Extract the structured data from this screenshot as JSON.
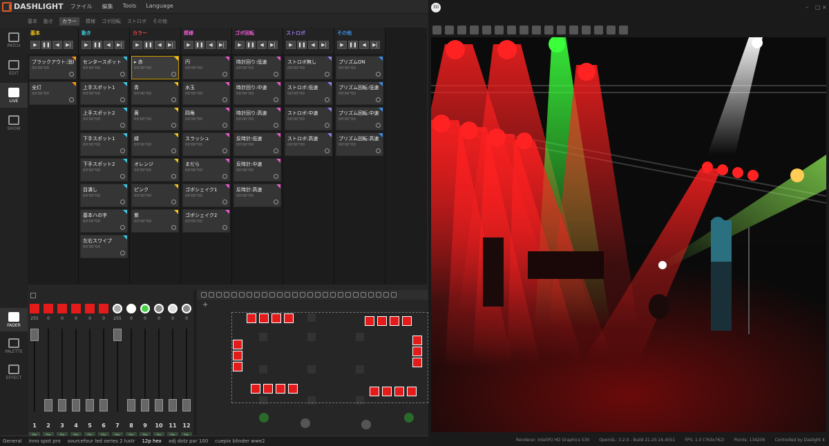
{
  "app": {
    "name": "DASHLIGHT"
  },
  "menu": [
    "ファイル",
    "編集",
    "Tools",
    "Language"
  ],
  "groups": [
    "基本",
    "動き",
    "カラー",
    "模様",
    "ゴボ回転",
    "ストロボ",
    "その他"
  ],
  "active_group": "カラー",
  "nav": {
    "patch": "PATCH",
    "edit": "EDIT",
    "live": "LIVE",
    "show": "SHOW"
  },
  "bnav": {
    "fader": "FADER",
    "palette": "PALETTE",
    "effect": "EFFECT"
  },
  "transport": {
    "play": "▶",
    "pause": "❚❚",
    "prev": "◀",
    "next": "▶|"
  },
  "columns": [
    {
      "name": "基本",
      "color": "#f5c518",
      "cues": [
        {
          "label": "ブラックアウト:消灯",
          "time": "00'00\"00",
          "tag": "#f90"
        },
        {
          "label": "全灯",
          "time": "00'00\"00",
          "tag": "#f90"
        }
      ]
    },
    {
      "name": "動き",
      "color": "#3cc8e0",
      "cues": [
        {
          "label": "センタースポット",
          "time": "00'00\"00",
          "tag": "#3cc8e0"
        },
        {
          "label": "上手スポット1",
          "time": "00'00\"00",
          "tag": "#3cc8e0"
        },
        {
          "label": "上手スポット2",
          "time": "00'00\"00",
          "tag": "#3cc8e0"
        },
        {
          "label": "下手スポット1",
          "time": "00'00\"00",
          "tag": "#3cc8e0"
        },
        {
          "label": "下手スポット2",
          "time": "00'00\"00",
          "tag": "#3cc8e0"
        },
        {
          "label": "目潰し",
          "time": "00'00\"00",
          "tag": "#3cc8e0"
        },
        {
          "label": "基本ハの字",
          "time": "00'00\"00",
          "tag": "#3cc8e0"
        },
        {
          "label": "左右スワイプ",
          "time": "00'00\"00",
          "tag": "#3cc8e0"
        }
      ]
    },
    {
      "name": "カラー",
      "color": "#e84a4a",
      "cues": [
        {
          "label": "▸ 赤",
          "time": "00'00\"00",
          "tag": "#f5c518"
        },
        {
          "label": "青",
          "time": "00'00\"00",
          "tag": "#f5c518"
        },
        {
          "label": "黄",
          "time": "00'00\"00",
          "tag": "#f5c518"
        },
        {
          "label": "緑",
          "time": "00'00\"00",
          "tag": "#f5c518"
        },
        {
          "label": "オレンジ",
          "time": "00'00\"00",
          "tag": "#f5c518"
        },
        {
          "label": "ピンク",
          "time": "00'00\"00",
          "tag": "#f5c518"
        },
        {
          "label": "紫",
          "time": "00'00\"00",
          "tag": "#f5c518"
        }
      ]
    },
    {
      "name": "模様",
      "color": "#e85ad0",
      "cues": [
        {
          "label": "円",
          "time": "00'00\"00",
          "tag": "#e85ad0"
        },
        {
          "label": "水玉",
          "time": "00'00\"00",
          "tag": "#e85ad0"
        },
        {
          "label": "四角",
          "time": "00'00\"00",
          "tag": "#e85ad0"
        },
        {
          "label": "スラッシュ",
          "time": "00'00\"00",
          "tag": "#e85ad0"
        },
        {
          "label": "まだら",
          "time": "00'00\"00",
          "tag": "#e85ad0"
        },
        {
          "label": "ゴボシェイク1",
          "time": "00'00\"00",
          "tag": "#e85ad0"
        },
        {
          "label": "ゴボシェイク2",
          "time": "00'00\"00",
          "tag": "#e85ad0"
        }
      ]
    },
    {
      "name": "ゴボ回転",
      "color": "#e85ad0",
      "cues": [
        {
          "label": "時計回り:低速",
          "time": "00'00\"00",
          "tag": "#e85ad0"
        },
        {
          "label": "時計回り:中速",
          "time": "00'00\"00",
          "tag": "#e85ad0"
        },
        {
          "label": "時計回り:高速",
          "time": "00'00\"00",
          "tag": "#e85ad0"
        },
        {
          "label": "反時計:低速",
          "time": "00'00\"00",
          "tag": "#e85ad0"
        },
        {
          "label": "反時計:中速",
          "time": "00'00\"00",
          "tag": "#e85ad0"
        },
        {
          "label": "反時計:高速",
          "time": "00'00\"00",
          "tag": "#e85ad0"
        }
      ]
    },
    {
      "name": "ストロボ",
      "color": "#9a7ae8",
      "cues": [
        {
          "label": "ストロボ無し",
          "time": "00'00\"00",
          "tag": "#9a7ae8"
        },
        {
          "label": "ストロボ:低速",
          "time": "00'00\"00",
          "tag": "#9a7ae8"
        },
        {
          "label": "ストロボ:中速",
          "time": "00'00\"00",
          "tag": "#9a7ae8"
        },
        {
          "label": "ストロボ:高速",
          "time": "00'00\"00",
          "tag": "#9a7ae8"
        }
      ]
    },
    {
      "name": "その他",
      "color": "#3c8ee8",
      "cues": [
        {
          "label": "プリズムON",
          "time": "00'00\"00",
          "tag": "#3c8ee8"
        },
        {
          "label": "プリズム回転:低速",
          "time": "00'00\"00",
          "tag": "#3c8ee8"
        },
        {
          "label": "プリズム回転:中速",
          "time": "00'00\"00",
          "tag": "#3c8ee8"
        },
        {
          "label": "プリズム回転:高速",
          "time": "00'00\"00",
          "tag": "#3c8ee8"
        }
      ]
    }
  ],
  "faders": [
    {
      "num": "1",
      "val": "255",
      "level": 1.0,
      "color": "#e31b1b"
    },
    {
      "num": "2",
      "val": "0",
      "level": 0.0,
      "color": "#e31b1b"
    },
    {
      "num": "3",
      "val": "0",
      "level": 0.0,
      "color": "#e31b1b"
    },
    {
      "num": "4",
      "val": "0",
      "level": 0.0,
      "color": "#e31b1b"
    },
    {
      "num": "5",
      "val": "0",
      "level": 0.0,
      "color": "#e31b1b"
    },
    {
      "num": "6",
      "val": "0",
      "level": 0.0,
      "color": "#e31b1b"
    },
    {
      "num": "7",
      "val": "255",
      "level": 1.0,
      "color": "#aaaaaa"
    },
    {
      "num": "8",
      "val": "0",
      "level": 0.0,
      "color": "#ffffff"
    },
    {
      "num": "9",
      "val": "0",
      "level": 0.0,
      "color": "#4ad14a"
    },
    {
      "num": "10",
      "val": "0",
      "level": 0.0,
      "color": "#888888"
    },
    {
      "num": "11",
      "val": "0",
      "level": 0.0,
      "color": "#dddddd"
    },
    {
      "num": "12",
      "val": "0",
      "level": 0.0,
      "color": "#888888"
    }
  ],
  "on_label": "On",
  "off_label": "Off",
  "grid_label": "+",
  "status_tabs": [
    {
      "label": "General"
    },
    {
      "label": "inno spot pro"
    },
    {
      "label": "sourcefour led series 2 lustr"
    },
    {
      "label": "12p hex",
      "active": true
    },
    {
      "label": "adj dotz par 100"
    },
    {
      "label": "cuepix blinder wwe2"
    }
  ],
  "view3d": {
    "badge": "3D",
    "status": [
      "Renderer: Intel(R) HD Graphics 530",
      "OpenGL: 3.2.0 - Build 21.20.16.4551",
      "FPS: 1.0 (763x762)",
      "Points: 134206",
      "Controlled by Daslight 4"
    ]
  }
}
